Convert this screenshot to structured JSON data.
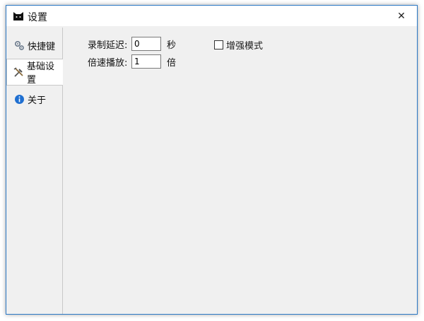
{
  "window": {
    "title": "设置",
    "close_glyph": "✕"
  },
  "tabs": [
    {
      "label": "快捷键",
      "icon": "gears-icon",
      "active": false
    },
    {
      "label": "基础设置",
      "icon": "tools-icon",
      "active": true
    },
    {
      "label": "关于",
      "icon": "info-icon",
      "active": false
    }
  ],
  "settings": {
    "record_delay": {
      "label": "录制延迟:",
      "value": "0",
      "unit": "秒"
    },
    "playback_speed": {
      "label": "倍速播放:",
      "value": "1",
      "unit": "倍"
    },
    "enhanced_mode": {
      "label": "增强模式",
      "checked": false
    }
  },
  "colors": {
    "window_border": "#2b78c5",
    "panel_background": "#f0f0f0",
    "info_icon": "#1f6fd1"
  }
}
